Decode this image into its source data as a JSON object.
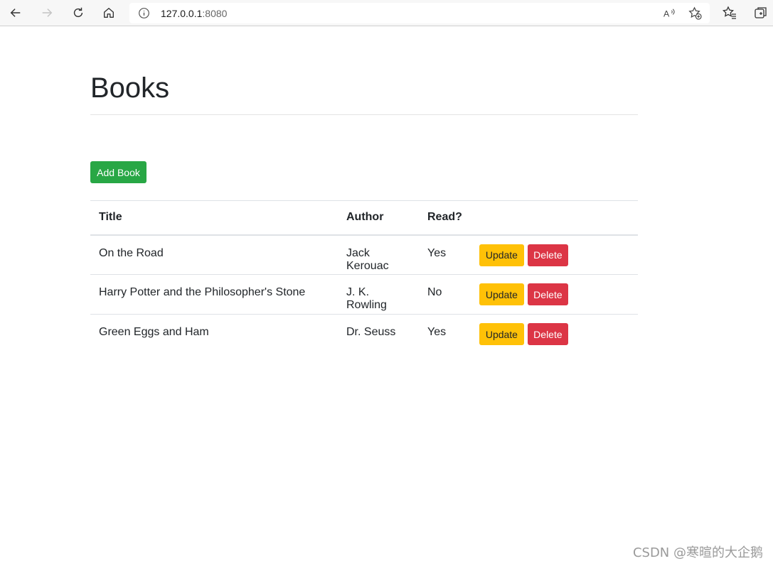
{
  "browser": {
    "url_host": "127.0.0.1",
    "url_port": ":8080",
    "icons": [
      "back-icon",
      "forward-icon",
      "refresh-icon",
      "home-icon",
      "info-icon",
      "read-aloud-icon",
      "add-favorite-icon",
      "favorites-icon",
      "collections-icon"
    ]
  },
  "page": {
    "title": "Books",
    "add_button": "Add Book",
    "table": {
      "headers": [
        "Title",
        "Author",
        "Read?",
        ""
      ],
      "rows": [
        {
          "title": "On the Road",
          "author": "Jack Kerouac",
          "read": "Yes"
        },
        {
          "title": "Harry Potter and the Philosopher's Stone",
          "author": "J. K. Rowling",
          "read": "No"
        },
        {
          "title": "Green Eggs and Ham",
          "author": "Dr. Seuss",
          "read": "Yes"
        }
      ],
      "update_label": "Update",
      "delete_label": "Delete"
    }
  },
  "colors": {
    "success": "#28a745",
    "warning": "#ffc107",
    "danger": "#dc3545"
  },
  "watermark": "CSDN @寒暄的大企鹅"
}
